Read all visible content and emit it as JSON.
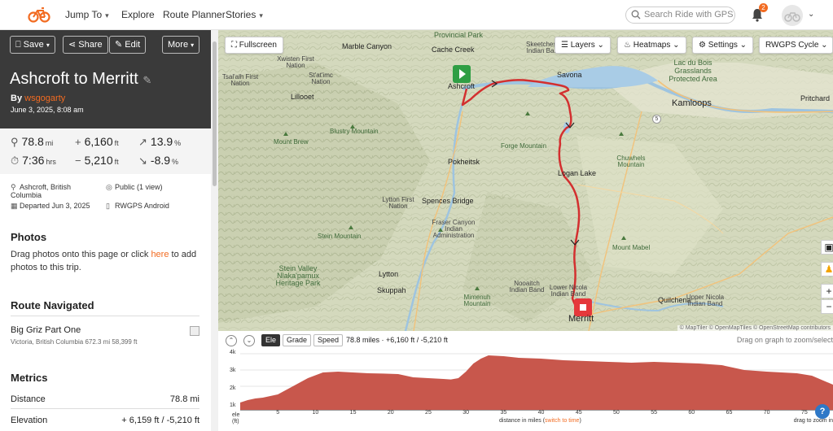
{
  "nav": {
    "items": [
      {
        "label": "Jump To",
        "has_menu": true
      },
      {
        "label": "Explore",
        "has_menu": false
      },
      {
        "label": "Route Planner",
        "has_menu": false
      },
      {
        "label": "Stories",
        "has_menu": true
      }
    ],
    "search_placeholder": "Search Ride with GPS",
    "notification_count": "2",
    "brand_color": "#f26b21"
  },
  "toolbar": {
    "save_label": "Save",
    "share_label": "Share",
    "edit_label": "Edit",
    "more_label": "More"
  },
  "ride": {
    "title": "Ashcroft to Merritt",
    "by_label": "By",
    "author": "wsgogarty",
    "date": "June 3, 2025, 8:08 am"
  },
  "stats": {
    "distance": "78.8",
    "distance_unit": "mi",
    "elev_gain": "6,160",
    "elev_gain_unit": "ft",
    "max_grade": "13.9",
    "max_grade_unit": "%",
    "moving_time": "7:36",
    "moving_time_unit": "hrs",
    "elev_loss": "5,210",
    "elev_loss_unit": "ft",
    "min_grade": "-8.9",
    "min_grade_unit": "%"
  },
  "meta": {
    "location": "Ashcroft, British Columbia",
    "visibility": "Public (1 view)",
    "departed": "Departed Jun 3, 2025",
    "device": "RWGPS Android"
  },
  "photos": {
    "title": "Photos",
    "text_before": "Drag photos onto this page or click ",
    "link": "here",
    "text_after": " to add photos to this trip."
  },
  "route_navigated": {
    "title": "Route Navigated",
    "name": "Big Griz Part One",
    "details": "Victoria, British Columbia   672.3 mi   58,399 ft"
  },
  "metrics": {
    "title": "Metrics",
    "rows": [
      {
        "label": "Distance",
        "value": "78.8 mi"
      },
      {
        "label": "Elevation",
        "value": "+ 6,159 ft / -5,210 ft"
      }
    ]
  },
  "map": {
    "fullscreen_label": "Fullscreen",
    "layers_label": "Layers",
    "heatmaps_label": "Heatmaps",
    "settings_label": "Settings",
    "basemap_label": "RWGPS Cycle",
    "attribution": "© MapTiler © OpenMapTiles © OpenStreetMap contributors",
    "labels": {
      "provincial_park": "Provincial Park",
      "cache_creek": "Cache Creek",
      "skeetchestn": "Skeetchestn Indian Band",
      "marble_canyon": "Marble Canyon",
      "xwisten": "Xwisten First Nation",
      "tsalalh": "Tsal'alh First Nation",
      "statimc": "St'at'imc Nation",
      "lillooet": "Lillooet",
      "ashcroft": "Ashcroft",
      "savona": "Savona",
      "lac_du_bois": "Lac du Bois Grasslands Protected Area",
      "kamloops": "Kamloops",
      "pritchard": "Pritchard",
      "blustry": "Blustry Mountain",
      "mount_brew": "Mount Brew",
      "forge": "Forge Mountain",
      "chuwhels": "Chuwhels Mountain",
      "pokheitsk": "Pokheitsk",
      "logan_lake": "Logan Lake",
      "lytton_fn": "Lytton First Nation",
      "spences": "Spences Bridge",
      "fraser": "Fraser Canyon Indian Administration",
      "stein": "Stein Mountain",
      "mount_mabel": "Mount Mabel",
      "stein_valley": "Stein Valley Nlaka'pamux Heritage Park",
      "lytton": "Lytton",
      "skuppah": "Skuppah",
      "nooaitch": "Nooaitch Indian Band",
      "lower_nicola": "Lower Nicola Indian Band",
      "mimenuh": "Mimenuh Mountain",
      "quilchena": "Quilchena",
      "upper_nicola": "Upper Nicola Indian Band",
      "merritt": "Merritt",
      "hwy5": "5"
    }
  },
  "elevation": {
    "tabs": [
      "Ele",
      "Grade",
      "Speed"
    ],
    "active_tab": "Ele",
    "summary": "78.8 miles · +6,160 ft / -5,210 ft",
    "hint": "Drag on graph to zoom/select",
    "y_labels": [
      "4k",
      "3k",
      "2k",
      "1k",
      "ele",
      "(ft)"
    ],
    "x_ticks": [
      "5",
      "10",
      "15",
      "20",
      "25",
      "30",
      "35",
      "40",
      "45",
      "50",
      "55",
      "60",
      "65",
      "70",
      "75"
    ],
    "x_axis_label": "distance in miles",
    "x_axis_link": "switch to time",
    "x_right": "drag to zoom in",
    "fill_color": "#c8574c"
  },
  "chart_data": {
    "type": "area",
    "xlabel": "distance in miles",
    "ylabel": "ele (ft)",
    "xlim": [
      0,
      78.8
    ],
    "ylim": [
      500,
      4200
    ],
    "x": [
      0,
      1,
      2,
      3,
      5,
      7,
      9,
      11,
      13,
      15,
      17,
      19,
      21,
      23,
      25,
      27,
      28,
      29,
      30,
      31,
      32,
      33,
      35,
      37,
      40,
      43,
      46,
      49,
      52,
      55,
      58,
      61,
      64,
      67,
      70,
      72,
      74,
      76,
      78.8
    ],
    "values": [
      1000,
      1150,
      1250,
      1300,
      1500,
      2000,
      2500,
      2850,
      2900,
      2850,
      2800,
      2780,
      2750,
      2550,
      2500,
      2450,
      2420,
      2500,
      2900,
      3400,
      3700,
      3900,
      3850,
      3750,
      3700,
      3600,
      3550,
      3500,
      3450,
      3500,
      3450,
      3400,
      3300,
      3000,
      2900,
      2850,
      2800,
      2650,
      2100
    ]
  }
}
